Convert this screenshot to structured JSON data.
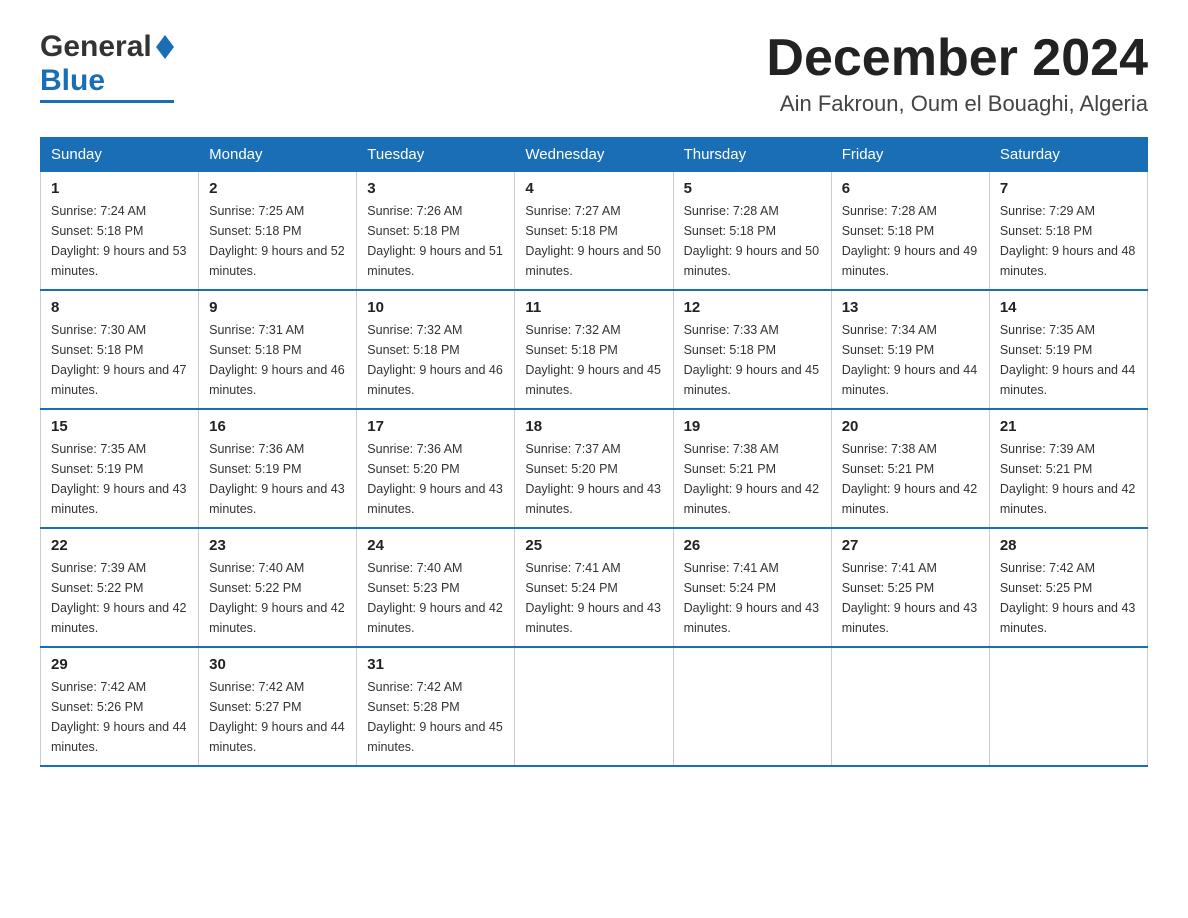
{
  "header": {
    "logo_general": "General",
    "logo_blue": "Blue",
    "month_title": "December 2024",
    "location": "Ain Fakroun, Oum el Bouaghi, Algeria"
  },
  "days_of_week": [
    "Sunday",
    "Monday",
    "Tuesday",
    "Wednesday",
    "Thursday",
    "Friday",
    "Saturday"
  ],
  "weeks": [
    [
      {
        "day": "1",
        "sunrise": "7:24 AM",
        "sunset": "5:18 PM",
        "daylight": "9 hours and 53 minutes."
      },
      {
        "day": "2",
        "sunrise": "7:25 AM",
        "sunset": "5:18 PM",
        "daylight": "9 hours and 52 minutes."
      },
      {
        "day": "3",
        "sunrise": "7:26 AM",
        "sunset": "5:18 PM",
        "daylight": "9 hours and 51 minutes."
      },
      {
        "day": "4",
        "sunrise": "7:27 AM",
        "sunset": "5:18 PM",
        "daylight": "9 hours and 50 minutes."
      },
      {
        "day": "5",
        "sunrise": "7:28 AM",
        "sunset": "5:18 PM",
        "daylight": "9 hours and 50 minutes."
      },
      {
        "day": "6",
        "sunrise": "7:28 AM",
        "sunset": "5:18 PM",
        "daylight": "9 hours and 49 minutes."
      },
      {
        "day": "7",
        "sunrise": "7:29 AM",
        "sunset": "5:18 PM",
        "daylight": "9 hours and 48 minutes."
      }
    ],
    [
      {
        "day": "8",
        "sunrise": "7:30 AM",
        "sunset": "5:18 PM",
        "daylight": "9 hours and 47 minutes."
      },
      {
        "day": "9",
        "sunrise": "7:31 AM",
        "sunset": "5:18 PM",
        "daylight": "9 hours and 46 minutes."
      },
      {
        "day": "10",
        "sunrise": "7:32 AM",
        "sunset": "5:18 PM",
        "daylight": "9 hours and 46 minutes."
      },
      {
        "day": "11",
        "sunrise": "7:32 AM",
        "sunset": "5:18 PM",
        "daylight": "9 hours and 45 minutes."
      },
      {
        "day": "12",
        "sunrise": "7:33 AM",
        "sunset": "5:18 PM",
        "daylight": "9 hours and 45 minutes."
      },
      {
        "day": "13",
        "sunrise": "7:34 AM",
        "sunset": "5:19 PM",
        "daylight": "9 hours and 44 minutes."
      },
      {
        "day": "14",
        "sunrise": "7:35 AM",
        "sunset": "5:19 PM",
        "daylight": "9 hours and 44 minutes."
      }
    ],
    [
      {
        "day": "15",
        "sunrise": "7:35 AM",
        "sunset": "5:19 PM",
        "daylight": "9 hours and 43 minutes."
      },
      {
        "day": "16",
        "sunrise": "7:36 AM",
        "sunset": "5:19 PM",
        "daylight": "9 hours and 43 minutes."
      },
      {
        "day": "17",
        "sunrise": "7:36 AM",
        "sunset": "5:20 PM",
        "daylight": "9 hours and 43 minutes."
      },
      {
        "day": "18",
        "sunrise": "7:37 AM",
        "sunset": "5:20 PM",
        "daylight": "9 hours and 43 minutes."
      },
      {
        "day": "19",
        "sunrise": "7:38 AM",
        "sunset": "5:21 PM",
        "daylight": "9 hours and 42 minutes."
      },
      {
        "day": "20",
        "sunrise": "7:38 AM",
        "sunset": "5:21 PM",
        "daylight": "9 hours and 42 minutes."
      },
      {
        "day": "21",
        "sunrise": "7:39 AM",
        "sunset": "5:21 PM",
        "daylight": "9 hours and 42 minutes."
      }
    ],
    [
      {
        "day": "22",
        "sunrise": "7:39 AM",
        "sunset": "5:22 PM",
        "daylight": "9 hours and 42 minutes."
      },
      {
        "day": "23",
        "sunrise": "7:40 AM",
        "sunset": "5:22 PM",
        "daylight": "9 hours and 42 minutes."
      },
      {
        "day": "24",
        "sunrise": "7:40 AM",
        "sunset": "5:23 PM",
        "daylight": "9 hours and 42 minutes."
      },
      {
        "day": "25",
        "sunrise": "7:41 AM",
        "sunset": "5:24 PM",
        "daylight": "9 hours and 43 minutes."
      },
      {
        "day": "26",
        "sunrise": "7:41 AM",
        "sunset": "5:24 PM",
        "daylight": "9 hours and 43 minutes."
      },
      {
        "day": "27",
        "sunrise": "7:41 AM",
        "sunset": "5:25 PM",
        "daylight": "9 hours and 43 minutes."
      },
      {
        "day": "28",
        "sunrise": "7:42 AM",
        "sunset": "5:25 PM",
        "daylight": "9 hours and 43 minutes."
      }
    ],
    [
      {
        "day": "29",
        "sunrise": "7:42 AM",
        "sunset": "5:26 PM",
        "daylight": "9 hours and 44 minutes."
      },
      {
        "day": "30",
        "sunrise": "7:42 AM",
        "sunset": "5:27 PM",
        "daylight": "9 hours and 44 minutes."
      },
      {
        "day": "31",
        "sunrise": "7:42 AM",
        "sunset": "5:28 PM",
        "daylight": "9 hours and 45 minutes."
      },
      null,
      null,
      null,
      null
    ]
  ]
}
